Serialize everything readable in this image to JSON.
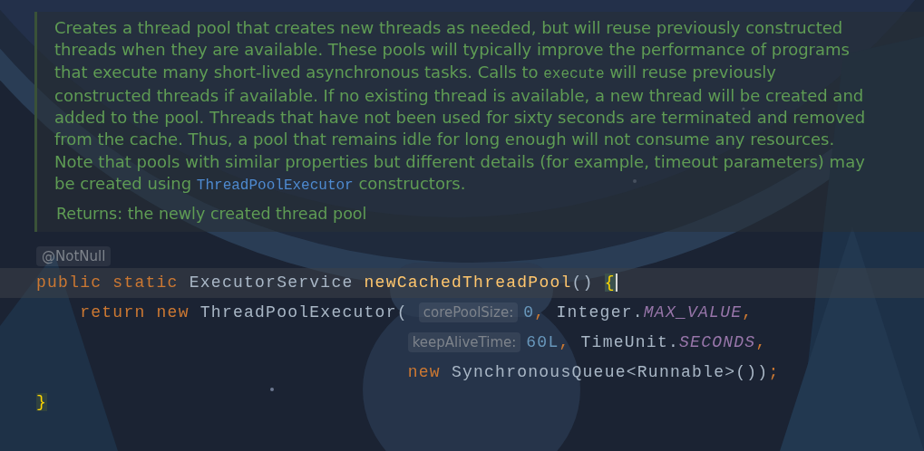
{
  "doc": {
    "lines": [
      [
        {
          "kind": "text",
          "text": "Creates a thread pool that creates new threads as needed, but will reuse previously constructed"
        }
      ],
      [
        {
          "kind": "text",
          "text": "threads when they are available. These pools will typically improve the performance of programs"
        }
      ],
      [
        {
          "kind": "text",
          "text": "that execute many short-lived asynchronous tasks. Calls to "
        },
        {
          "kind": "code",
          "text": "execute"
        },
        {
          "kind": "text",
          "text": " will reuse previously"
        }
      ],
      [
        {
          "kind": "text",
          "text": "constructed threads if available. If no existing thread is available, a new thread will be created and"
        }
      ],
      [
        {
          "kind": "text",
          "text": "added to the pool. Threads that have not been used for sixty seconds are terminated and removed"
        }
      ],
      [
        {
          "kind": "text",
          "text": "from the cache. Thus, a pool that remains idle for long enough will not consume any resources."
        }
      ],
      [
        {
          "kind": "text",
          "text": "Note that pools with similar properties but different details (for example, timeout parameters) may"
        }
      ],
      [
        {
          "kind": "text",
          "text": "be created using "
        },
        {
          "kind": "link",
          "text": "ThreadPoolExecutor"
        },
        {
          "kind": "text",
          "text": " constructors."
        }
      ]
    ],
    "returns": "Returns: the newly created thread pool"
  },
  "annotation_hint": "@NotNull",
  "code": [
    {
      "current": true,
      "tokens": [
        {
          "kind": "keyword",
          "text": "public static "
        },
        {
          "kind": "type",
          "text": "ExecutorService "
        },
        {
          "kind": "method",
          "text": "newCachedThreadPool"
        },
        {
          "kind": "plain",
          "text": "() "
        },
        {
          "kind": "brace-match",
          "text": "{"
        }
      ]
    },
    {
      "current": false,
      "tokens": [
        {
          "kind": "keyword",
          "text": "    return new "
        },
        {
          "kind": "plain",
          "text": "ThreadPoolExecutor( "
        },
        {
          "kind": "hint",
          "text": "corePoolSize:"
        },
        {
          "kind": "number",
          "text": "0"
        },
        {
          "kind": "comma",
          "text": ", "
        },
        {
          "kind": "plain",
          "text": "Integer."
        },
        {
          "kind": "const",
          "text": "MAX_VALUE"
        },
        {
          "kind": "comma",
          "text": ","
        }
      ]
    },
    {
      "current": false,
      "continuation": true,
      "tokens": [
        {
          "kind": "hint",
          "text": "keepAliveTime:"
        },
        {
          "kind": "number",
          "text": "60L"
        },
        {
          "kind": "comma",
          "text": ", "
        },
        {
          "kind": "plain",
          "text": "TimeUnit."
        },
        {
          "kind": "const",
          "text": "SECONDS"
        },
        {
          "kind": "comma",
          "text": ","
        }
      ]
    },
    {
      "current": false,
      "continuation": true,
      "tokens": [
        {
          "kind": "keyword",
          "text": "new "
        },
        {
          "kind": "plain",
          "text": "SynchronousQueue<Runnable>())"
        },
        {
          "kind": "comma",
          "text": ";"
        }
      ]
    },
    {
      "current": false,
      "tokens": [
        {
          "kind": "brace",
          "text": "}"
        }
      ]
    }
  ]
}
